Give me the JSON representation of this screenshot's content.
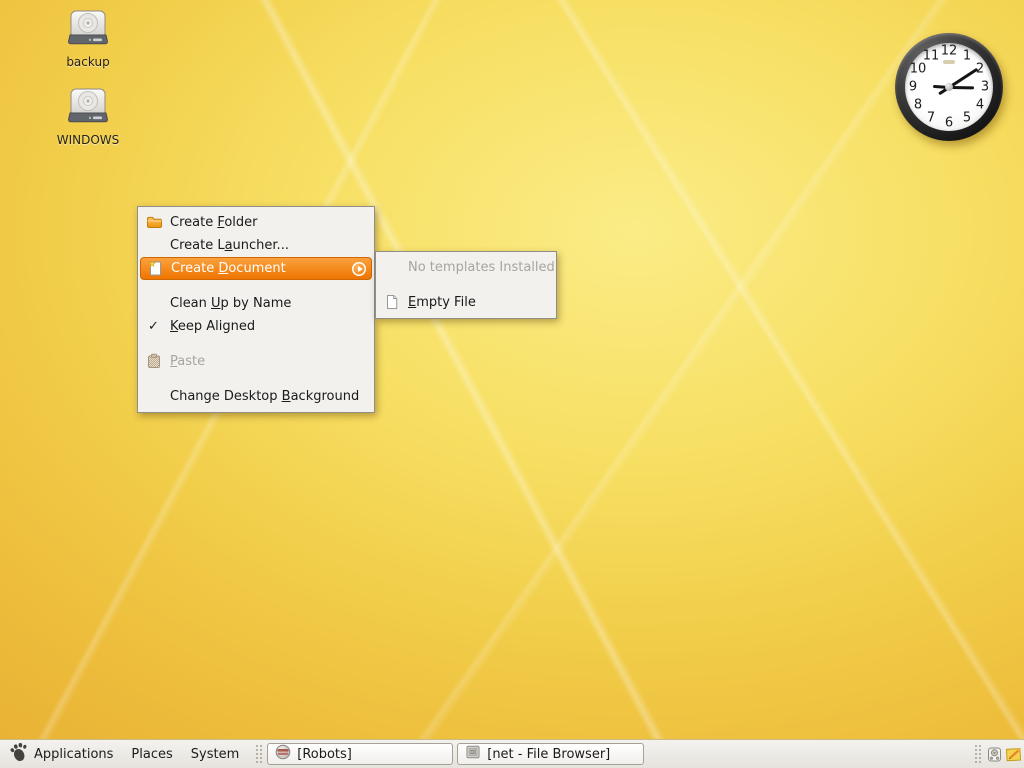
{
  "colors": {
    "wallpaper_gold": "#eab636",
    "wallpaper_light": "#fbec86",
    "menu_highlight_orange": "#f57900",
    "panel_bg": "#edebe7",
    "menu_bg": "#f2f1ee"
  },
  "desktop_icons": [
    {
      "label": "backup",
      "icon": "hard-drive-icon"
    },
    {
      "label": "WINDOWS",
      "icon": "hard-drive-icon"
    }
  ],
  "clock": {
    "style": "analog",
    "approx_time": "3:10",
    "numbers": [
      "12",
      "1",
      "2",
      "3",
      "4",
      "5",
      "6",
      "7",
      "8",
      "9",
      "10",
      "11"
    ]
  },
  "context_menu": {
    "items": [
      {
        "label": "Create Folder",
        "u": 7,
        "icon": "folder-icon",
        "state": "normal"
      },
      {
        "label": "Create Launcher...",
        "u": 8,
        "state": "normal"
      },
      {
        "label": "Create Document",
        "u": 7,
        "icon": "new-document-icon",
        "state": "highlighted",
        "has_submenu": true
      },
      {
        "type": "separator"
      },
      {
        "label": "Clean Up by Name",
        "u": 6,
        "state": "normal"
      },
      {
        "label": "Keep Aligned",
        "u": 0,
        "checked": true,
        "state": "normal"
      },
      {
        "type": "separator"
      },
      {
        "label": "Paste",
        "u": 0,
        "icon": "paste-icon",
        "state": "disabled"
      },
      {
        "type": "separator"
      },
      {
        "label": "Change Desktop Background",
        "u": 15,
        "state": "normal"
      }
    ]
  },
  "submenu": {
    "items": [
      {
        "label": "No templates Installed",
        "state": "disabled"
      },
      {
        "label": "Empty File",
        "u": 0,
        "icon": "document-icon",
        "state": "normal"
      }
    ]
  },
  "panel": {
    "menus": [
      {
        "label": "Applications",
        "icon": "gnome-foot-icon"
      },
      {
        "label": "Places"
      },
      {
        "label": "System"
      }
    ],
    "window_buttons": [
      {
        "label": "[Robots]",
        "icon": "robots-icon"
      },
      {
        "label": "[net - File Browser]",
        "icon": "file-browser-icon"
      }
    ],
    "tray_icons": [
      "volume-icon",
      "sticky-notes-icon"
    ]
  }
}
